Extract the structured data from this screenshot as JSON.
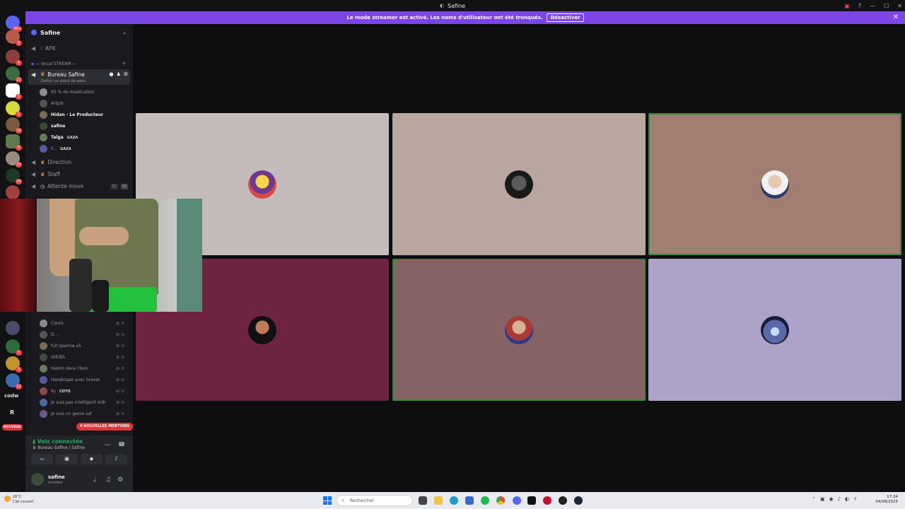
{
  "window": {
    "title": "Safine"
  },
  "banner": {
    "message": "Le mode streamer est activé. Les noms d'utilisateur ont été tronqués.",
    "button": "Désactiver"
  },
  "servers": {
    "badges": [
      "99+",
      "8",
      "4",
      "21",
      "6",
      "5",
      "10",
      "8",
      "15",
      "34",
      "7",
      "3",
      "11"
    ],
    "text_items": [
      "codw",
      "R"
    ],
    "new_label": "NOUVEAU"
  },
  "guild": {
    "name": "Safine"
  },
  "channels": {
    "afk": "AFK",
    "category": "— Vocal STREAM —",
    "bureau": "Bureau Safine",
    "bureau_status": "Définir un statut de salon",
    "direction": "Direction",
    "staff": "Staff",
    "attente": "Attente move",
    "attente_count": "32",
    "attente_limit": "99"
  },
  "voice_users_top": [
    {
      "name": "95 % de mastication",
      "color": "#949ba4"
    },
    {
      "name": "Artpik",
      "color": "#949ba4"
    },
    {
      "name": "Hidan - Le Producteur",
      "color": "#f2f3f5"
    },
    {
      "name": "safine",
      "color": "#f2f3f5"
    },
    {
      "name": "Talga",
      "tag": "GAZA",
      "color": "#f2f3f5"
    },
    {
      "name": "Y...",
      "tag": "GAZA",
      "color": "#949ba4"
    }
  ],
  "voice_users_bottom": [
    {
      "name": "Clxxis"
    },
    {
      "name": "D..."
    },
    {
      "name": "full sperme x5"
    },
    {
      "name": "GIESEL"
    },
    {
      "name": "Hakim dans l'bon"
    },
    {
      "name": "Handicapé avec brevet"
    },
    {
      "name": "Ily",
      "tag": "COTO"
    },
    {
      "name": "Je suis pas intelligent mdr"
    },
    {
      "name": "je suis un genie saf"
    }
  ],
  "mentions": "4 NOUVELLES MENTIONS",
  "voice_connection": {
    "status": "Voix connectée",
    "channel": "Bureau Safine / Safine"
  },
  "user": {
    "name": "safine",
    "status": "Invisible"
  },
  "tiles": [
    {
      "bg": "#c4bcbb",
      "speaking": false
    },
    {
      "bg": "#b9a69f",
      "speaking": false
    },
    {
      "bg": "#a37c72",
      "speaking": true
    },
    {
      "bg": "#6e2440",
      "speaking": false
    },
    {
      "bg": "#866264",
      "speaking": true
    },
    {
      "bg": "#ada3c9",
      "speaking": false
    }
  ],
  "taskbar": {
    "temp": "26°C",
    "weather": "Ciel couvert",
    "search_placeholder": "Rechercher",
    "time": "17:24",
    "date": "04/08/2025"
  },
  "colors": {
    "accent": "#7c45e8",
    "green": "#23a55a",
    "red": "#da373c"
  }
}
